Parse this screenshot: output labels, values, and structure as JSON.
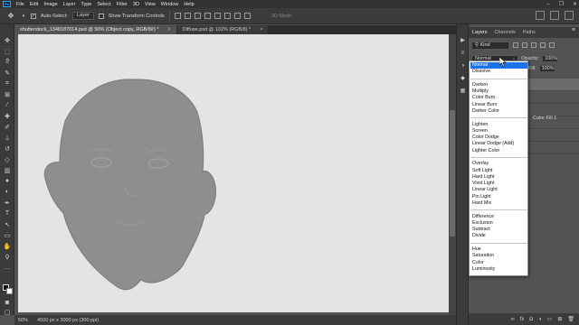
{
  "menubar": {
    "logo": "Ps",
    "items": [
      "File",
      "Edit",
      "Image",
      "Layer",
      "Type",
      "Select",
      "Filter",
      "3D",
      "View",
      "Window",
      "Help"
    ],
    "window_controls": [
      "–",
      "❐",
      "✕"
    ]
  },
  "options": {
    "auto_select_label": "Auto-Select:",
    "auto_select_value": "Layer",
    "transform_label": "Show Transform Controls",
    "mode_3d": "3D Mode:"
  },
  "tabs": [
    {
      "label": "shutterstock_1348187014.psd @ 50% (Object copy, RGB/8#) *",
      "close": "×"
    },
    {
      "label": "Diffuse.psd @ 102% (RGB/8) *",
      "close": "×"
    }
  ],
  "status": {
    "zoom": "50%",
    "doc_info": "4500 px x 3000 px (300 ppi)"
  },
  "layers_panel": {
    "tabs": [
      "Layers",
      "Channels",
      "Paths"
    ],
    "menu_icon": "≡",
    "kind": "Kind",
    "blend_mode": "Normal",
    "opacity_label": "Opacity:",
    "opacity_value": "100%",
    "fill_label": "Fill:",
    "fill_value": "100%",
    "visible_layer_label": "Color Fill 1",
    "footer_icons": [
      "link-icon",
      "fx-icon",
      "mask-icon",
      "adjustment-icon",
      "group-icon",
      "new-layer-icon",
      "trash-icon"
    ]
  },
  "blend_dropdown": {
    "selected": "Normal",
    "groups": [
      [
        "Normal",
        "Dissolve"
      ],
      [
        "Darken",
        "Multiply",
        "Color Burn",
        "Linear Burn",
        "Darker Color"
      ],
      [
        "Lighten",
        "Screen",
        "Color Dodge",
        "Linear Dodge (Add)",
        "Lighter Color"
      ],
      [
        "Overlay",
        "Soft Light",
        "Hard Light",
        "Vivid Light",
        "Linear Light",
        "Pin Light",
        "Hard Mix"
      ],
      [
        "Difference",
        "Exclusion",
        "Subtract",
        "Divide"
      ],
      [
        "Hue",
        "Saturation",
        "Color",
        "Luminosity"
      ]
    ]
  },
  "colors": {
    "accent": "#1a73e8",
    "canvas_bg": "#e4e4e4",
    "face_fill": "#8e8e8e",
    "ui_dark": "#3b3b3b"
  }
}
